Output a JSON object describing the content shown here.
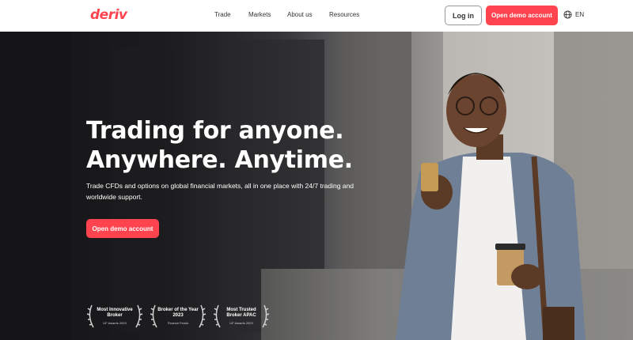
{
  "brand": {
    "logo_text": "deriv",
    "accent_color": "#ff444f"
  },
  "nav": {
    "items": [
      {
        "label": "Trade"
      },
      {
        "label": "Markets"
      },
      {
        "label": "About us"
      },
      {
        "label": "Resources"
      }
    ]
  },
  "header": {
    "login_label": "Log in",
    "demo_label": "Open demo account",
    "language": "EN",
    "language_icon": "globe-icon"
  },
  "hero": {
    "headline_line1": "Trading for anyone.",
    "headline_line2": "Anywhere. Anytime.",
    "subtext": "Trade CFDs and options on global financial markets, all in one place with 24/7 trading and worldwide support.",
    "cta_label": "Open demo account"
  },
  "awards": [
    {
      "title": "Most Innovative Broker",
      "source": "UF Awards 2023"
    },
    {
      "title": "Broker of the Year 2023",
      "source": "Finance Feeds"
    },
    {
      "title": "Most Trusted Broker APAC",
      "source": "UF Awards 2023"
    }
  ]
}
